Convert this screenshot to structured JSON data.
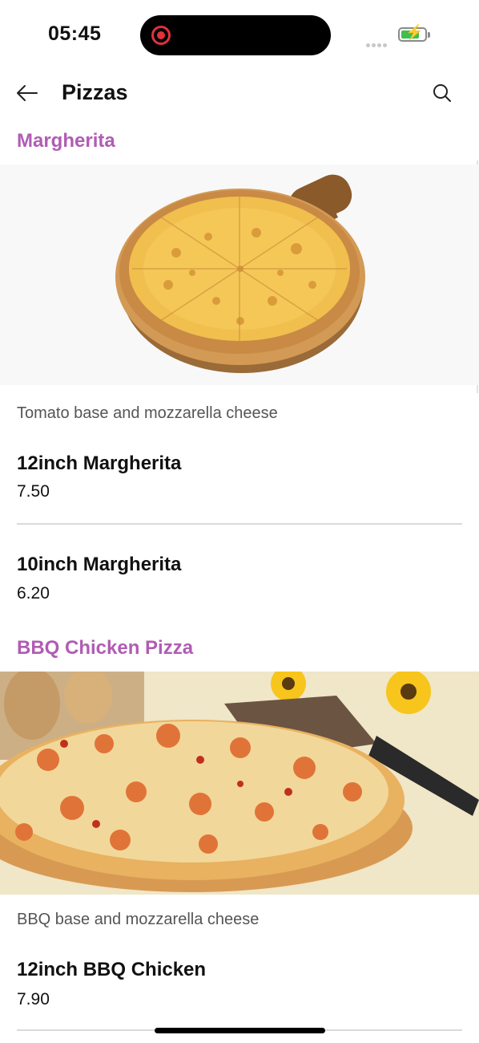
{
  "status_bar": {
    "time": "05:45",
    "battery_level": 0.8
  },
  "header": {
    "title": "Pizzas",
    "back_icon": "arrow-left-icon",
    "search_icon": "search-icon"
  },
  "categories": [
    {
      "title": "Margherita",
      "description": "Tomato base and mozzarella cheese",
      "items": [
        {
          "name": "12inch Margherita",
          "price": "7.50"
        },
        {
          "name": "10inch Margherita",
          "price": "6.20"
        }
      ]
    },
    {
      "title": "BBQ Chicken Pizza",
      "description": "BBQ base and mozzarella cheese",
      "items": [
        {
          "name": "12inch BBQ Chicken",
          "price": "7.90"
        }
      ]
    }
  ],
  "colors": {
    "accent": "#b05cb4",
    "divider": "#dadada",
    "text": "#111111",
    "muted": "#555555"
  }
}
